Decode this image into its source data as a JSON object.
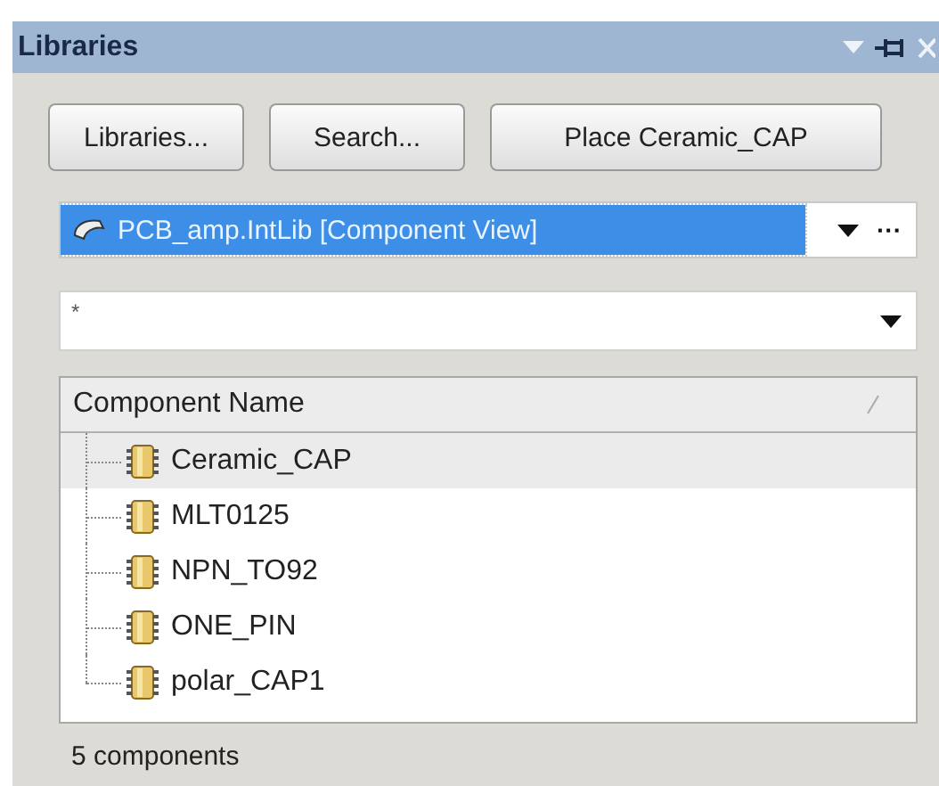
{
  "panel": {
    "title": "Libraries"
  },
  "buttons": [
    "Libraries...",
    "Search...",
    "Place Ceramic_CAP"
  ],
  "library_select": {
    "value": "PCB_amp.IntLib [Component View]",
    "more": "···"
  },
  "filter": {
    "value": "*"
  },
  "table": {
    "columns": [
      "Component Name"
    ],
    "rows": [
      {
        "name": "Ceramic_CAP",
        "selected": true
      },
      {
        "name": "MLT0125",
        "selected": false
      },
      {
        "name": "NPN_TO92",
        "selected": false
      },
      {
        "name": "ONE_PIN",
        "selected": false
      },
      {
        "name": "polar_CAP1",
        "selected": false
      }
    ]
  },
  "status_bar": "5 components"
}
